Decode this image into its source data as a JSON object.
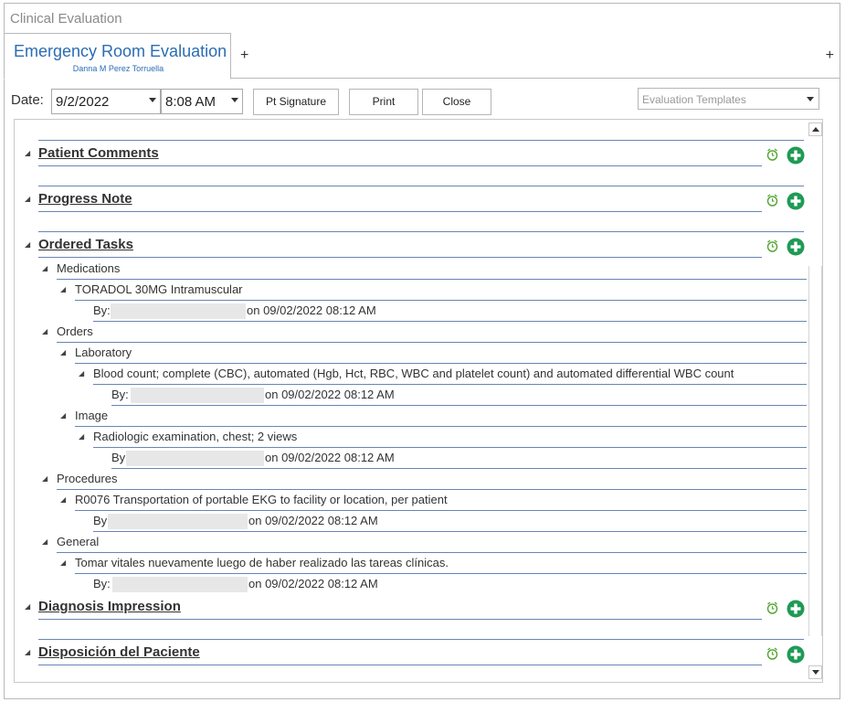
{
  "window": {
    "title": "Clinical Evaluation"
  },
  "tab": {
    "title": "Emergency Room Evaluation",
    "subtitle": "Danna M Perez Torruella",
    "add_label": "+",
    "add_right_label": "+"
  },
  "toolbar": {
    "date_label": "Date:",
    "date_value": "9/2/2022",
    "time_value": "8:08 AM",
    "pt_signature_label": "Pt Signature",
    "print_label": "Print",
    "close_label": "Close",
    "templates_placeholder": "Evaluation Templates"
  },
  "sections": {
    "patient_comments": "Patient Comments",
    "progress_note": "Progress Note",
    "ordered_tasks": "Ordered Tasks",
    "diagnosis_impression": "Diagnosis Impression",
    "disposicion": "Disposición del Paciente"
  },
  "tasks": {
    "medications": "Medications",
    "toradol": "TORADOL 30MG  Intramuscular",
    "toradol_by": "By:",
    "toradol_on": "on 09/02/2022 08:12 AM",
    "orders": "Orders",
    "laboratory": "Laboratory",
    "blood_count": "Blood count; complete (CBC), automated (Hgb, Hct, RBC, WBC and platelet count) and automated differential WBC count",
    "blood_by": "By:",
    "blood_on": "on 09/02/2022 08:12 AM",
    "image": "Image",
    "radiologic": "Radiologic examination, chest; 2 views",
    "radiologic_by": "By",
    "radiologic_on": "on 09/02/2022 08:12 AM",
    "procedures": "Procedures",
    "ekg": "R0076 Transportation of portable EKG to facility or location, per patient",
    "ekg_by": "By",
    "ekg_on": "on 09/02/2022 08:12 AM",
    "general": "General",
    "vitales": "Tomar vitales nuevamente luego de haber realizado las tareas clínicas.",
    "vitales_by": "By:",
    "vitales_on": "on 09/02/2022 08:12 AM"
  },
  "colors": {
    "accent": "#2b6cb3",
    "add_green": "#1f9a55",
    "alarm_green": "#5aa83a",
    "divider": "#6b84b4"
  },
  "icons": {
    "expand": "triangle-down-icon",
    "alarm": "alarm-clock-icon",
    "add": "plus-circle-icon"
  }
}
